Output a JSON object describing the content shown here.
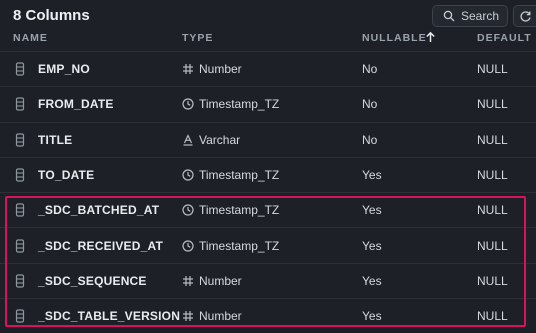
{
  "header": {
    "title": "8 Columns",
    "search_label": "Search"
  },
  "columns_header": {
    "name": "NAME",
    "type": "TYPE",
    "nullable": "NULLABLE",
    "default": "DEFAULT"
  },
  "sort": {
    "column": "nullable",
    "direction": "ascending",
    "icon": "arrow-up-icon"
  },
  "rows": [
    {
      "name": "EMP_NO",
      "type": "Number",
      "type_icon": "hash-icon",
      "nullable": "No",
      "default": "NULL"
    },
    {
      "name": "FROM_DATE",
      "type": "Timestamp_TZ",
      "type_icon": "clock-icon",
      "nullable": "No",
      "default": "NULL"
    },
    {
      "name": "TITLE",
      "type": "Varchar",
      "type_icon": "text-icon",
      "nullable": "No",
      "default": "NULL"
    },
    {
      "name": "TO_DATE",
      "type": "Timestamp_TZ",
      "type_icon": "clock-icon",
      "nullable": "Yes",
      "default": "NULL"
    },
    {
      "name": "_SDC_BATCHED_AT",
      "type": "Timestamp_TZ",
      "type_icon": "clock-icon",
      "nullable": "Yes",
      "default": "NULL"
    },
    {
      "name": "_SDC_RECEIVED_AT",
      "type": "Timestamp_TZ",
      "type_icon": "clock-icon",
      "nullable": "Yes",
      "default": "NULL"
    },
    {
      "name": "_SDC_SEQUENCE",
      "type": "Number",
      "type_icon": "hash-icon",
      "nullable": "Yes",
      "default": "NULL"
    },
    {
      "name": "_SDC_TABLE_VERSION",
      "type": "Number",
      "type_icon": "hash-icon",
      "nullable": "Yes",
      "default": "NULL"
    }
  ],
  "colors": {
    "background": "#1d2127",
    "highlight": "#d8125b"
  }
}
